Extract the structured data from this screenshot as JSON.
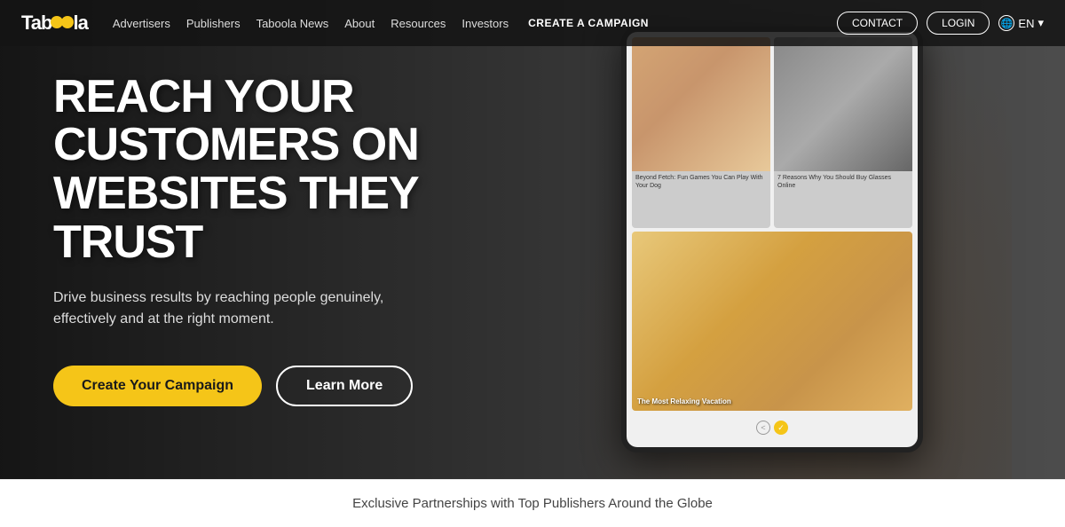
{
  "navbar": {
    "logo": "Taboola",
    "links": [
      {
        "label": "Advertisers",
        "name": "nav-advertisers"
      },
      {
        "label": "Publishers",
        "name": "nav-publishers"
      },
      {
        "label": "Taboola News",
        "name": "nav-taboola-news"
      },
      {
        "label": "About",
        "name": "nav-about"
      },
      {
        "label": "Resources",
        "name": "nav-resources"
      },
      {
        "label": "Investors",
        "name": "nav-investors"
      },
      {
        "label": "CREATE A CAMPAIGN",
        "name": "nav-create-campaign"
      }
    ],
    "contact_label": "CONTACT",
    "login_label": "LOGIN",
    "lang_label": "EN"
  },
  "hero": {
    "title": "REACH YOUR CUSTOMERS ON WEBSITES THEY TRUST",
    "subtitle": "Drive business results by reaching people genuinely, effectively and at the right moment.",
    "cta_primary": "Create Your Campaign",
    "cta_secondary": "Learn More"
  },
  "tablet": {
    "card1_text": "Beyond Fetch: Fun Games You Can Play With Your Dog",
    "card2_text": "7 Reasons Why You Should Buy Glasses Online",
    "big_card_text": "The Most Relaxing Vacation"
  },
  "footer": {
    "text": "Exclusive Partnerships with Top Publishers Around the Globe"
  }
}
